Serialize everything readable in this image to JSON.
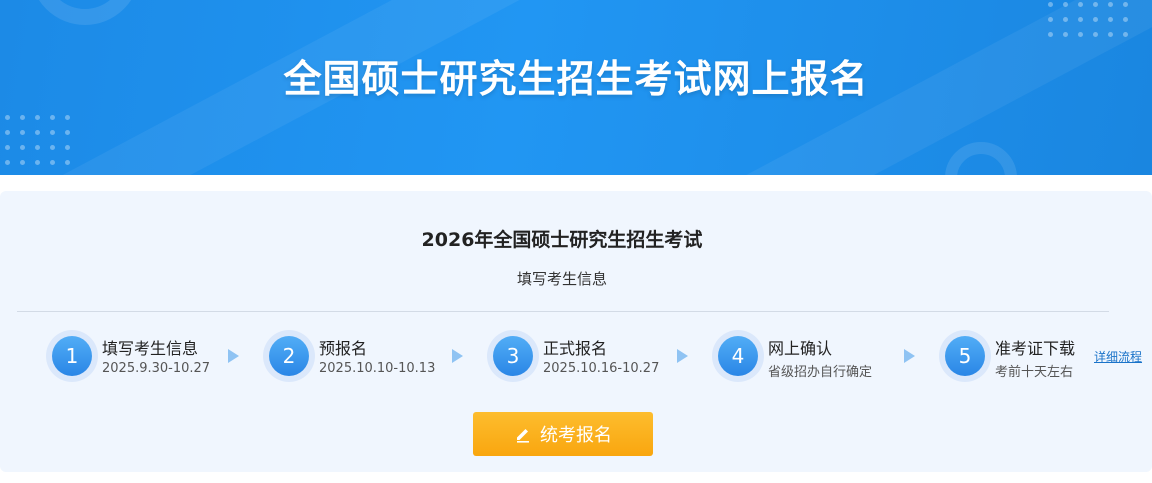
{
  "banner": {
    "title": "全国硕士研究生招生考试网上报名"
  },
  "panel": {
    "exam_title": "2026年全国硕士研究生招生考试",
    "subtitle": "填写考生信息",
    "steps": [
      {
        "number": "1",
        "label": "填写考生信息",
        "date": "2025.9.30-10.27"
      },
      {
        "number": "2",
        "label": "预报名",
        "date": "2025.10.10-10.13"
      },
      {
        "number": "3",
        "label": "正式报名",
        "date": "2025.10.16-10.27"
      },
      {
        "number": "4",
        "label": "网上确认",
        "date": "省级招办自行确定"
      },
      {
        "number": "5",
        "label": "准考证下载",
        "date": "考前十天左右"
      }
    ],
    "detail_link": "详细流程",
    "register_button": "统考报名"
  },
  "colors": {
    "banner_blue": "#2196f3",
    "step_circle": "#2a86e6",
    "button_orange": "#f9a60f",
    "link_blue": "#1a73c9"
  }
}
